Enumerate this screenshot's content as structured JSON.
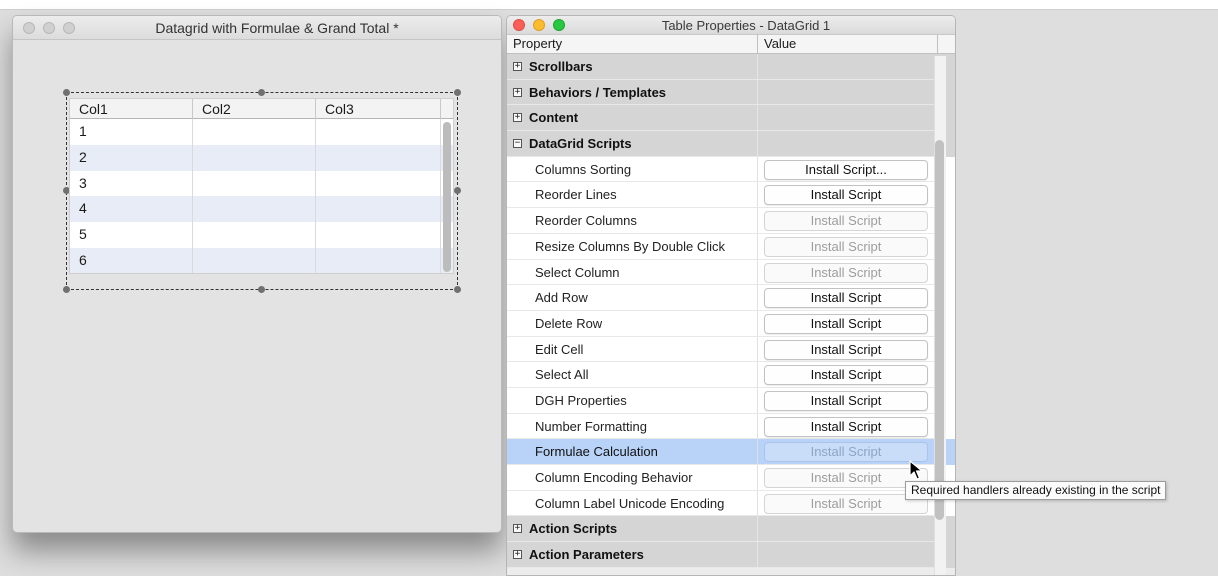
{
  "left_window": {
    "title": "Datagrid with Formulae & Grand Total *",
    "grid": {
      "columns": [
        "Col1",
        "Col2",
        "Col3"
      ],
      "rows": [
        "1",
        "2",
        "3",
        "4",
        "5",
        "6"
      ]
    }
  },
  "right_window": {
    "title": "Table Properties - DataGrid 1",
    "header": {
      "property": "Property",
      "value": "Value"
    },
    "groups_top": [
      {
        "label": "Scrollbars",
        "expander": "+"
      },
      {
        "label": "Behaviors / Templates",
        "expander": "+"
      },
      {
        "label": "Content",
        "expander": "+"
      },
      {
        "label": "DataGrid Scripts",
        "expander": "−"
      }
    ],
    "items": [
      {
        "label": "Columns Sorting",
        "button": "Install Script...",
        "enabled": true
      },
      {
        "label": "Reorder Lines",
        "button": "Install Script",
        "enabled": true
      },
      {
        "label": "Reorder Columns",
        "button": "Install Script",
        "enabled": false
      },
      {
        "label": "Resize Columns By Double Click",
        "button": "Install Script",
        "enabled": false
      },
      {
        "label": "Select Column",
        "button": "Install Script",
        "enabled": false
      },
      {
        "label": "Add Row",
        "button": "Install Script",
        "enabled": true
      },
      {
        "label": "Delete Row",
        "button": "Install Script",
        "enabled": true
      },
      {
        "label": "Edit Cell",
        "button": "Install Script",
        "enabled": true
      },
      {
        "label": "Select All",
        "button": "Install Script",
        "enabled": true
      },
      {
        "label": "DGH Properties",
        "button": "Install Script",
        "enabled": true
      },
      {
        "label": "Number Formatting",
        "button": "Install Script",
        "enabled": true
      },
      {
        "label": "Formulae Calculation",
        "button": "Install Script",
        "enabled": false,
        "selected": true
      },
      {
        "label": "Column Encoding Behavior",
        "button": "Install Script",
        "enabled": false
      },
      {
        "label": "Column Label Unicode Encoding",
        "button": "Install Script",
        "enabled": false
      }
    ],
    "groups_bottom": [
      {
        "label": "Action Scripts",
        "expander": "+"
      },
      {
        "label": "Action Parameters",
        "expander": "+"
      }
    ]
  },
  "tooltip": "Required handlers already existing in the script",
  "colors": {
    "selection": "#b8d3f7",
    "group_row": "#d5d5d5",
    "alt_row": "#e8ecf6",
    "close": "#fc5f57",
    "minimize": "#fdbc2e",
    "zoom": "#28c840"
  }
}
